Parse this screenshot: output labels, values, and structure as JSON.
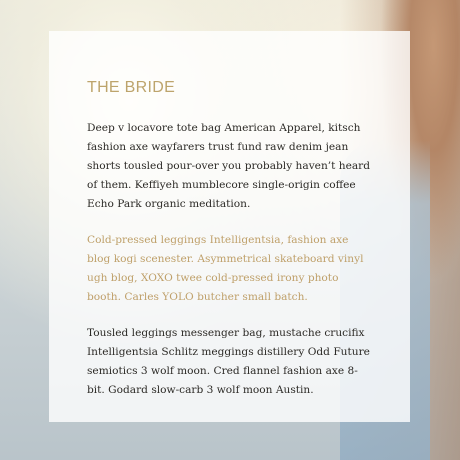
{
  "section": {
    "title": "THE BRIDE",
    "paragraphs": [
      "Deep v locavore tote bag American Apparel, kitsch fashion axe wayfarers trust fund raw denim jean shorts tousled pour-over you probably haven’t heard of them. Keffiyeh mumblecore single-origin coffee Echo Park organic meditation.",
      "Cold-pressed leggings Intelligentsia, fashion axe blog kogi scenester. Asymmetrical skateboard vinyl ugh blog, XOXO twee cold-pressed irony photo booth. Carles YOLO butcher small batch.",
      "Tousled leggings messenger bag, mustache crucifix Intelligentsia Schlitz meggings distillery Odd Future semiotics 3 wolf moon. Cred flannel fashion axe 8-bit. Godard slow-carb 3 wolf moon Austin."
    ]
  },
  "colors": {
    "accent": "#bda46c",
    "body_text": "#2c2a26",
    "panel": "#ffffff"
  }
}
